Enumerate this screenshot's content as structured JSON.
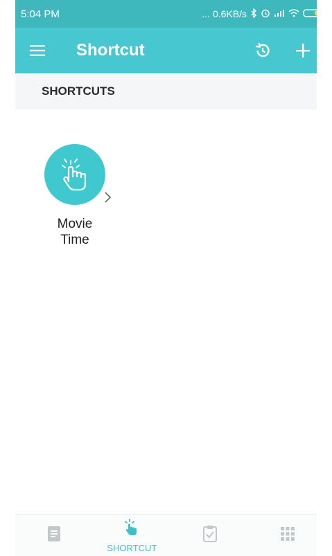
{
  "status_bar": {
    "time": "5:04 PM",
    "net_speed": "... 0.6KB/s"
  },
  "app_bar": {
    "title": "Shortcut",
    "menu_icon": "hamburger-menu-icon",
    "history_icon": "history-icon",
    "add_icon": "plus-icon"
  },
  "section": {
    "title": "SHORTCUTS"
  },
  "shortcuts": [
    {
      "label_line1": "Movie",
      "label_line2": "Time",
      "icon": "tap-hand-icon"
    }
  ],
  "bottom_nav": {
    "items": [
      {
        "name": "overview",
        "icon": "document-icon",
        "label": ""
      },
      {
        "name": "shortcut",
        "icon": "tap-hand-icon",
        "label": "SHORTCUT",
        "active": true
      },
      {
        "name": "tasks",
        "icon": "clipboard-check-icon",
        "label": ""
      },
      {
        "name": "more",
        "icon": "grid-icon",
        "label": ""
      }
    ]
  },
  "colors": {
    "accent": "#47c7cf",
    "status_bar": "#3fb8bd",
    "inactive_icon": "#c3c7c9"
  }
}
